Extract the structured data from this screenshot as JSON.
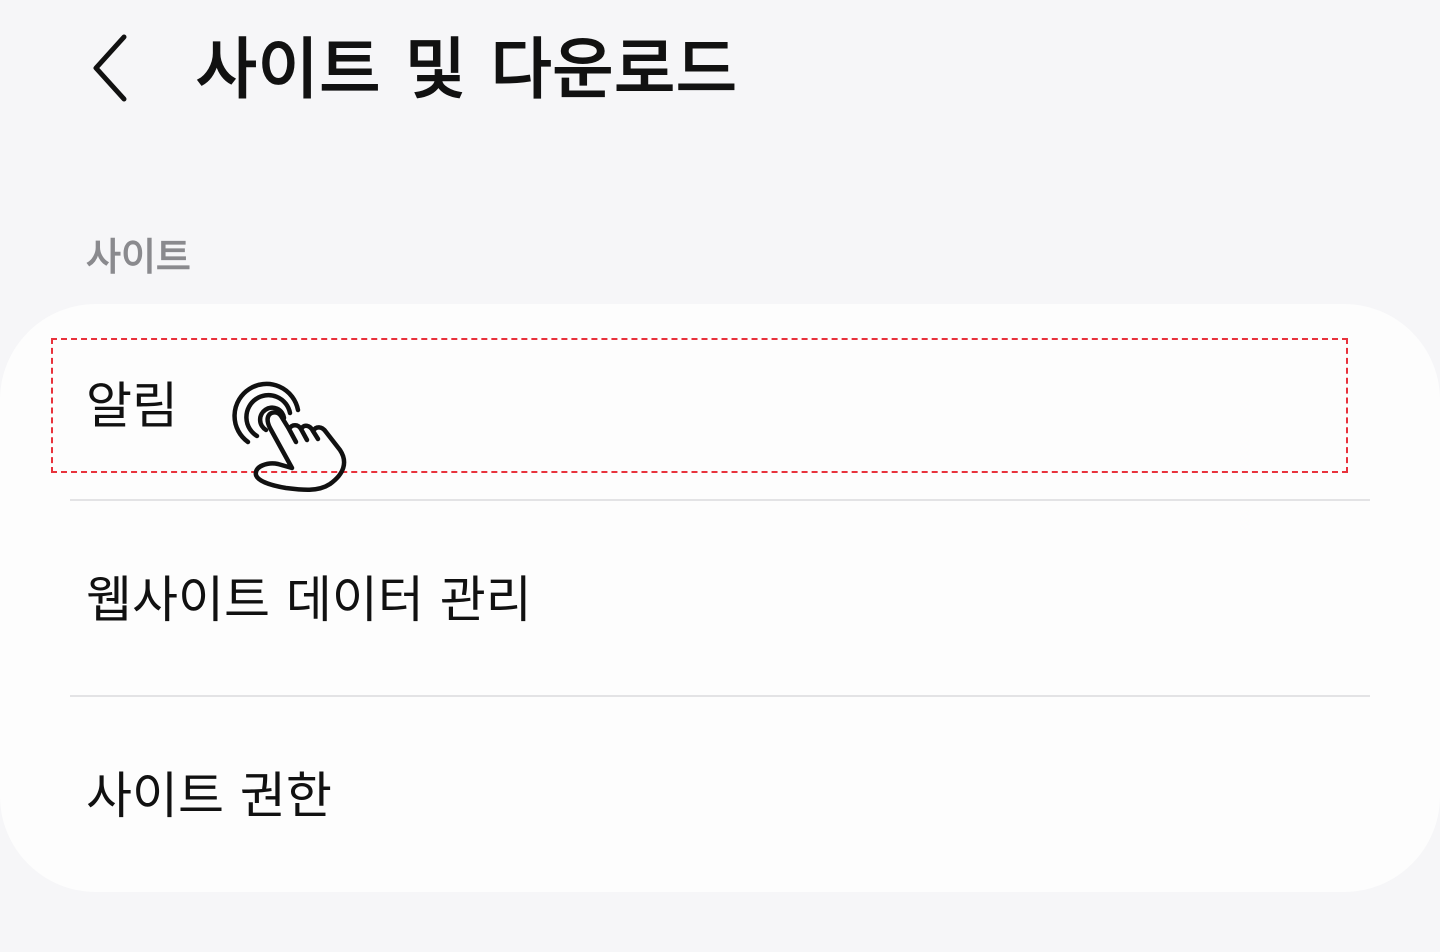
{
  "header": {
    "back_icon": "chevron-left-icon",
    "title": "사이트 및 다운로드"
  },
  "section": {
    "label": "사이트"
  },
  "items": [
    {
      "label": "알림"
    },
    {
      "label": "웹사이트 데이터 관리"
    },
    {
      "label": "사이트 권한"
    }
  ],
  "overlay": {
    "highlight_color": "#e8323c",
    "tap_icon": "tap-gesture-icon"
  },
  "colors": {
    "background": "#f6f6f8",
    "card": "#fdfdfd",
    "section_label": "#8a8a8e",
    "divider": "#e3e3e5",
    "text": "#111111"
  }
}
